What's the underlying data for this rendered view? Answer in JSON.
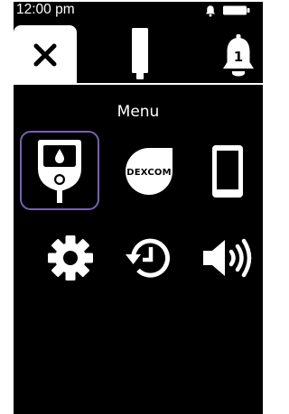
{
  "status_bar": {
    "time": "12:00 pm",
    "icons": [
      "bell-icon",
      "battery-icon"
    ]
  },
  "tabs": [
    {
      "name": "close",
      "icon": "close-icon",
      "active": true
    },
    {
      "name": "sensor",
      "icon": "sensor-icon",
      "active": false
    },
    {
      "name": "alerts",
      "icon": "bell-icon",
      "badge": "1",
      "active": false
    }
  ],
  "menu": {
    "title": "Menu",
    "items": [
      {
        "id": "meter",
        "icon": "blood-glucose-meter-icon",
        "selected": true
      },
      {
        "id": "dexcom",
        "icon": "dexcom-icon",
        "label": "DEXCOM"
      },
      {
        "id": "phone",
        "icon": "phone-icon"
      },
      {
        "id": "settings",
        "icon": "gear-icon"
      },
      {
        "id": "history",
        "icon": "history-icon"
      },
      {
        "id": "sound",
        "icon": "speaker-icon"
      }
    ]
  },
  "colors": {
    "background": "#000000",
    "foreground": "#ffffff",
    "selection": "#7a5fb4"
  }
}
